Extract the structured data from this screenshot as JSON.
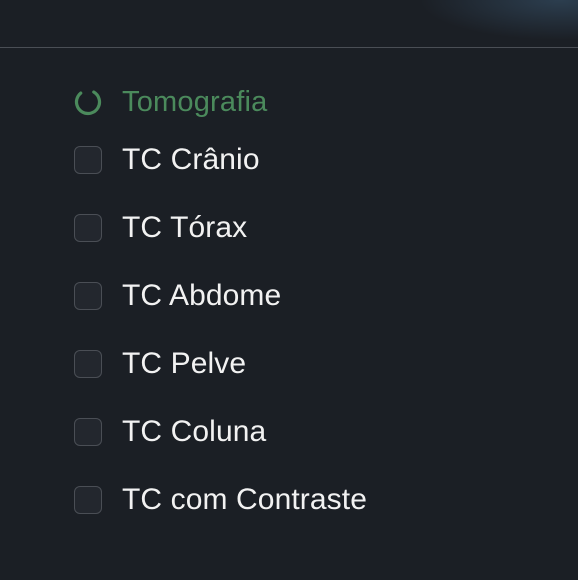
{
  "section": {
    "title": "Tomografia",
    "icon": "loading-spinner-icon",
    "accent_color": "#4b8a5c"
  },
  "options": [
    {
      "label": "TC Crânio",
      "checked": false
    },
    {
      "label": "TC Tórax",
      "checked": false
    },
    {
      "label": "TC Abdome",
      "checked": false
    },
    {
      "label": "TC Pelve",
      "checked": false
    },
    {
      "label": "TC Coluna",
      "checked": false
    },
    {
      "label": "TC com Contraste",
      "checked": false
    }
  ]
}
